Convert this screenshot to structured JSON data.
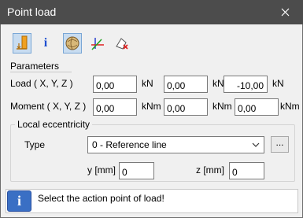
{
  "window": {
    "title": "Point load"
  },
  "toolbar": {
    "info_glyph": "i"
  },
  "parameters": {
    "section_label": "Parameters",
    "load": {
      "label": "Load ( X, Y, Z )",
      "x": "0,00",
      "y": "0,00",
      "z": "-10,00",
      "unit": "kN"
    },
    "moment": {
      "label": "Moment ( X, Y, Z )",
      "x": "0,00",
      "y": "0,00",
      "z": "0,00",
      "unit": "kNm"
    }
  },
  "local_eccentricity": {
    "group_label": "Local eccentricity",
    "type_label": "Type",
    "type_value": "0 - Reference line",
    "browse_label": "...",
    "y_label": "y [mm]",
    "y_value": "0",
    "z_label": "z [mm]",
    "z_value": "0"
  },
  "status": {
    "message": "Select the action point of load!",
    "icon_glyph": "i"
  },
  "colors": {
    "titlebar": "#4c4c4c",
    "accent": "#3a6fc4",
    "active_tool": "#c8dcf0"
  }
}
